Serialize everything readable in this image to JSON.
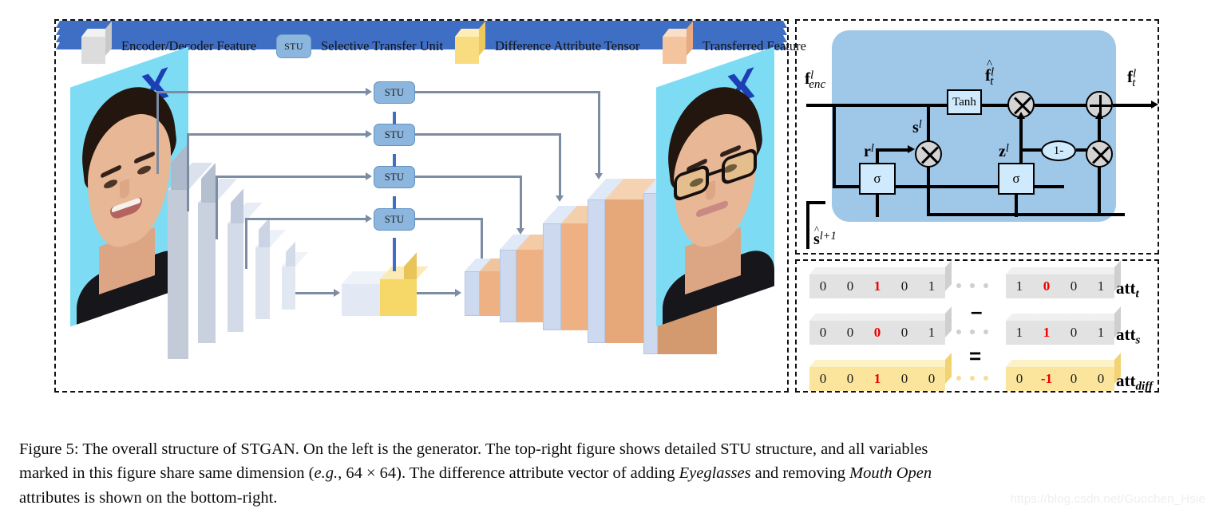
{
  "figure": {
    "caption_line1": "Figure 5: The overall structure of STGAN. On the left is the generator. The top-right figure shows detailed STU structure, and all variables",
    "caption_line2_a": "marked in this figure share same dimension (",
    "caption_line2_em1": "e.g.",
    "caption_line2_b": ", 64 × 64). The difference attribute vector of adding ",
    "caption_line2_em2": "Eyeglasses",
    "caption_line2_c": " and removing ",
    "caption_line2_em3": "Mouth Open",
    "caption_line3": "attributes is shown on the bottom-right.",
    "watermark": "https://blog.csdn.net/Guochen_Hsie"
  },
  "legend": {
    "items": [
      {
        "icon": "gray-cube-icon",
        "label": "Encoder/Decoder Feature"
      },
      {
        "icon": "stu-chip-icon",
        "label": "Selective Transfer Unit",
        "chip_text": "STU"
      },
      {
        "icon": "yellow-cube-icon",
        "label": "Difference Attribute Tensor"
      },
      {
        "icon": "orange-cube-icon",
        "label": "Transferred Feature"
      }
    ]
  },
  "generator": {
    "input_photo_alt": "input face photo smiling with open mouth, no glasses",
    "output_photo_alt": "output face photo with eyeglasses and closed mouth",
    "stu_nodes": [
      "STU",
      "STU",
      "STU",
      "STU"
    ],
    "stu_label": "STU"
  },
  "stu_detail": {
    "input_label": "f",
    "input_sub": "enc",
    "input_sup": "l",
    "output_label": "f",
    "output_sub": "t",
    "output_sup": "l",
    "hat_label": "f",
    "hat_sub": "t",
    "hat_sup": "l",
    "state_in_label": "s",
    "state_in_sup": "l+1",
    "r_label": "r",
    "r_sup": "l",
    "s_label": "s",
    "s_sup": "l",
    "z_label": "z",
    "z_sup": "l",
    "tanh_label": "Tanh",
    "sigma_label": "σ",
    "one_minus_label": "1-"
  },
  "attributes": {
    "rows": [
      {
        "name": "att_t",
        "label_main": "att",
        "label_sub": "t",
        "style": "gray",
        "left_cells": [
          {
            "v": "0",
            "red": false
          },
          {
            "v": "0",
            "red": false
          },
          {
            "v": "1",
            "red": true
          },
          {
            "v": "0",
            "red": false
          },
          {
            "v": "1",
            "red": false
          }
        ],
        "right_cells": [
          {
            "v": "1",
            "red": false
          },
          {
            "v": "0",
            "red": true
          },
          {
            "v": "0",
            "red": false
          },
          {
            "v": "1",
            "red": false
          }
        ]
      },
      {
        "name": "att_s",
        "label_main": "att",
        "label_sub": "s",
        "style": "gray",
        "left_cells": [
          {
            "v": "0",
            "red": false
          },
          {
            "v": "0",
            "red": false
          },
          {
            "v": "0",
            "red": true
          },
          {
            "v": "0",
            "red": false
          },
          {
            "v": "1",
            "red": false
          }
        ],
        "right_cells": [
          {
            "v": "1",
            "red": false
          },
          {
            "v": "1",
            "red": true
          },
          {
            "v": "0",
            "red": false
          },
          {
            "v": "1",
            "red": false
          }
        ]
      },
      {
        "name": "att_diff",
        "label_main": "att",
        "label_sub": "diff",
        "style": "yellow",
        "left_cells": [
          {
            "v": "0",
            "red": false
          },
          {
            "v": "0",
            "red": false
          },
          {
            "v": "1",
            "red": true
          },
          {
            "v": "0",
            "red": false
          },
          {
            "v": "0",
            "red": false
          }
        ],
        "right_cells": [
          {
            "v": "0",
            "red": false
          },
          {
            "v": "-1",
            "red": true
          },
          {
            "v": "0",
            "red": false
          },
          {
            "v": "0",
            "red": false
          }
        ]
      }
    ],
    "minus_sign": "–",
    "equals_sign": "="
  },
  "colors": {
    "stu_blue": "#8cb6dd",
    "stu_panel_blue": "#9ec7e8",
    "gate_blue": "#cfeafc",
    "encoder_gray": "#c3cbd9",
    "decoder_blue": "#ccd9ef",
    "transferred_orange": "#eeb183",
    "diff_yellow": "#f6d868",
    "arrow_gray": "#7b8ca3",
    "arrow_blue": "#3f6fc4",
    "red_digit": "#ee0000"
  }
}
